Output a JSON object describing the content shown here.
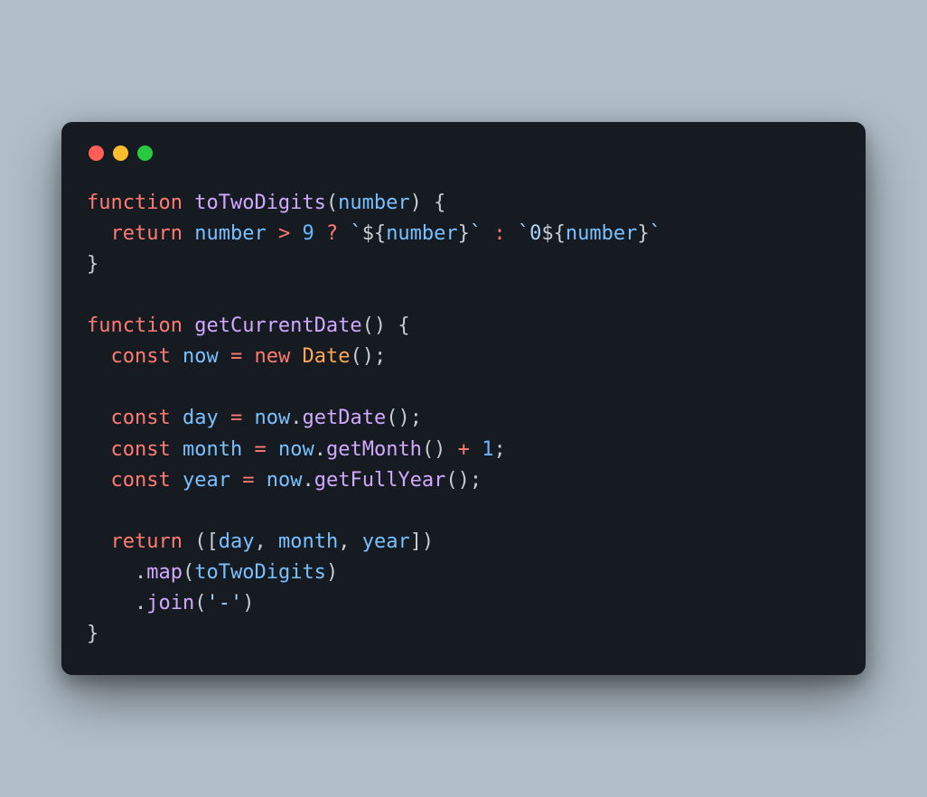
{
  "window": {
    "traffic_lights": {
      "red": "#ff5f56",
      "yellow": "#ffbd2e",
      "green": "#27c93f"
    }
  },
  "code": {
    "tokens": [
      {
        "t": "function ",
        "c": "kw"
      },
      {
        "t": "toTwoDigits",
        "c": "fn"
      },
      {
        "t": "(",
        "c": "punct"
      },
      {
        "t": "number",
        "c": "id"
      },
      {
        "t": ") {",
        "c": "punct"
      },
      {
        "t": "\n",
        "c": ""
      },
      {
        "t": "  ",
        "c": ""
      },
      {
        "t": "return ",
        "c": "kw"
      },
      {
        "t": "number ",
        "c": "id"
      },
      {
        "t": "> ",
        "c": "op"
      },
      {
        "t": "9",
        "c": "num"
      },
      {
        "t": " ? ",
        "c": "op"
      },
      {
        "t": "`",
        "c": "str"
      },
      {
        "t": "${",
        "c": "punct"
      },
      {
        "t": "number",
        "c": "id"
      },
      {
        "t": "}",
        "c": "punct"
      },
      {
        "t": "`",
        "c": "str"
      },
      {
        "t": " : ",
        "c": "op"
      },
      {
        "t": "`",
        "c": "str"
      },
      {
        "t": "0",
        "c": "str"
      },
      {
        "t": "${",
        "c": "punct"
      },
      {
        "t": "number",
        "c": "id"
      },
      {
        "t": "}",
        "c": "punct"
      },
      {
        "t": "`",
        "c": "str"
      },
      {
        "t": "\n",
        "c": ""
      },
      {
        "t": "}",
        "c": "punct"
      },
      {
        "t": "\n",
        "c": ""
      },
      {
        "t": "\n",
        "c": ""
      },
      {
        "t": "function ",
        "c": "kw"
      },
      {
        "t": "getCurrentDate",
        "c": "fn"
      },
      {
        "t": "() {",
        "c": "punct"
      },
      {
        "t": "\n",
        "c": ""
      },
      {
        "t": "  ",
        "c": ""
      },
      {
        "t": "const ",
        "c": "kw"
      },
      {
        "t": "now",
        "c": "id"
      },
      {
        "t": " = ",
        "c": "op"
      },
      {
        "t": "new ",
        "c": "kw"
      },
      {
        "t": "Date",
        "c": "cls"
      },
      {
        "t": "();",
        "c": "punct"
      },
      {
        "t": "\n",
        "c": ""
      },
      {
        "t": "\n",
        "c": ""
      },
      {
        "t": "  ",
        "c": ""
      },
      {
        "t": "const ",
        "c": "kw"
      },
      {
        "t": "day",
        "c": "id"
      },
      {
        "t": " = ",
        "c": "op"
      },
      {
        "t": "now",
        "c": "id"
      },
      {
        "t": ".",
        "c": "punct"
      },
      {
        "t": "getDate",
        "c": "fn"
      },
      {
        "t": "();",
        "c": "punct"
      },
      {
        "t": "\n",
        "c": ""
      },
      {
        "t": "  ",
        "c": ""
      },
      {
        "t": "const ",
        "c": "kw"
      },
      {
        "t": "month",
        "c": "id"
      },
      {
        "t": " = ",
        "c": "op"
      },
      {
        "t": "now",
        "c": "id"
      },
      {
        "t": ".",
        "c": "punct"
      },
      {
        "t": "getMonth",
        "c": "fn"
      },
      {
        "t": "()",
        "c": "punct"
      },
      {
        "t": " + ",
        "c": "op"
      },
      {
        "t": "1",
        "c": "num"
      },
      {
        "t": ";",
        "c": "punct"
      },
      {
        "t": "\n",
        "c": ""
      },
      {
        "t": "  ",
        "c": ""
      },
      {
        "t": "const ",
        "c": "kw"
      },
      {
        "t": "year",
        "c": "id"
      },
      {
        "t": " = ",
        "c": "op"
      },
      {
        "t": "now",
        "c": "id"
      },
      {
        "t": ".",
        "c": "punct"
      },
      {
        "t": "getFullYear",
        "c": "fn"
      },
      {
        "t": "();",
        "c": "punct"
      },
      {
        "t": "\n",
        "c": ""
      },
      {
        "t": "\n",
        "c": ""
      },
      {
        "t": "  ",
        "c": ""
      },
      {
        "t": "return ",
        "c": "kw"
      },
      {
        "t": "([",
        "c": "punct"
      },
      {
        "t": "day",
        "c": "id"
      },
      {
        "t": ", ",
        "c": "punct"
      },
      {
        "t": "month",
        "c": "id"
      },
      {
        "t": ", ",
        "c": "punct"
      },
      {
        "t": "year",
        "c": "id"
      },
      {
        "t": "])",
        "c": "punct"
      },
      {
        "t": "\n",
        "c": ""
      },
      {
        "t": "    .",
        "c": "punct"
      },
      {
        "t": "map",
        "c": "fn"
      },
      {
        "t": "(",
        "c": "punct"
      },
      {
        "t": "toTwoDigits",
        "c": "id"
      },
      {
        "t": ")",
        "c": "punct"
      },
      {
        "t": "\n",
        "c": ""
      },
      {
        "t": "    .",
        "c": "punct"
      },
      {
        "t": "join",
        "c": "fn"
      },
      {
        "t": "(",
        "c": "punct"
      },
      {
        "t": "'-'",
        "c": "str"
      },
      {
        "t": ")",
        "c": "punct"
      },
      {
        "t": "\n",
        "c": ""
      },
      {
        "t": "}",
        "c": "punct"
      }
    ]
  }
}
